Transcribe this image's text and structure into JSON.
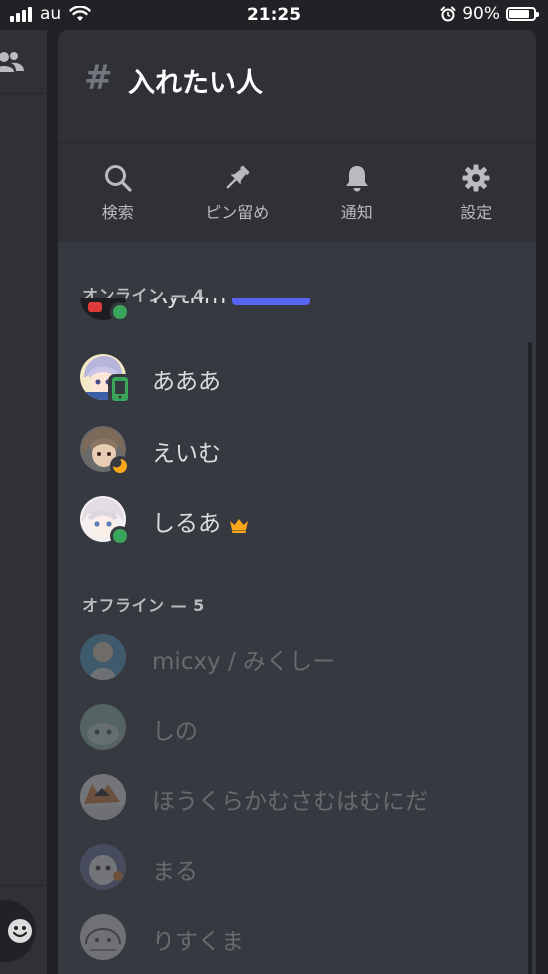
{
  "status_bar": {
    "carrier": "au",
    "time": "21:25",
    "battery": "90%",
    "battery_level": 0.9
  },
  "channel": {
    "hash": "#",
    "name": "入れたい人"
  },
  "actions": [
    {
      "label": "検索",
      "icon": "search-icon"
    },
    {
      "label": "ピン留め",
      "icon": "pin-icon"
    },
    {
      "label": "通知",
      "icon": "bell-icon"
    },
    {
      "label": "設定",
      "icon": "gear-icon"
    }
  ],
  "online": {
    "header": "オンライン — 4",
    "partial_member": "Rythm",
    "members": [
      {
        "name": "あああ",
        "status": "mobile"
      },
      {
        "name": "えいむ",
        "status": "idle"
      },
      {
        "name": "しるあ",
        "status": "online",
        "owner": true
      }
    ]
  },
  "offline": {
    "header": "オフライン — 5",
    "members": [
      {
        "name": "micxy / みくしー"
      },
      {
        "name": "しの"
      },
      {
        "name": "ほうくらかむさむはむにだ"
      },
      {
        "name": "まる"
      },
      {
        "name": "りすくま"
      }
    ]
  },
  "colors": {
    "online": "#3ba55c",
    "idle": "#faa81a",
    "crown": "#faa61a",
    "accent": "#5865f2"
  }
}
